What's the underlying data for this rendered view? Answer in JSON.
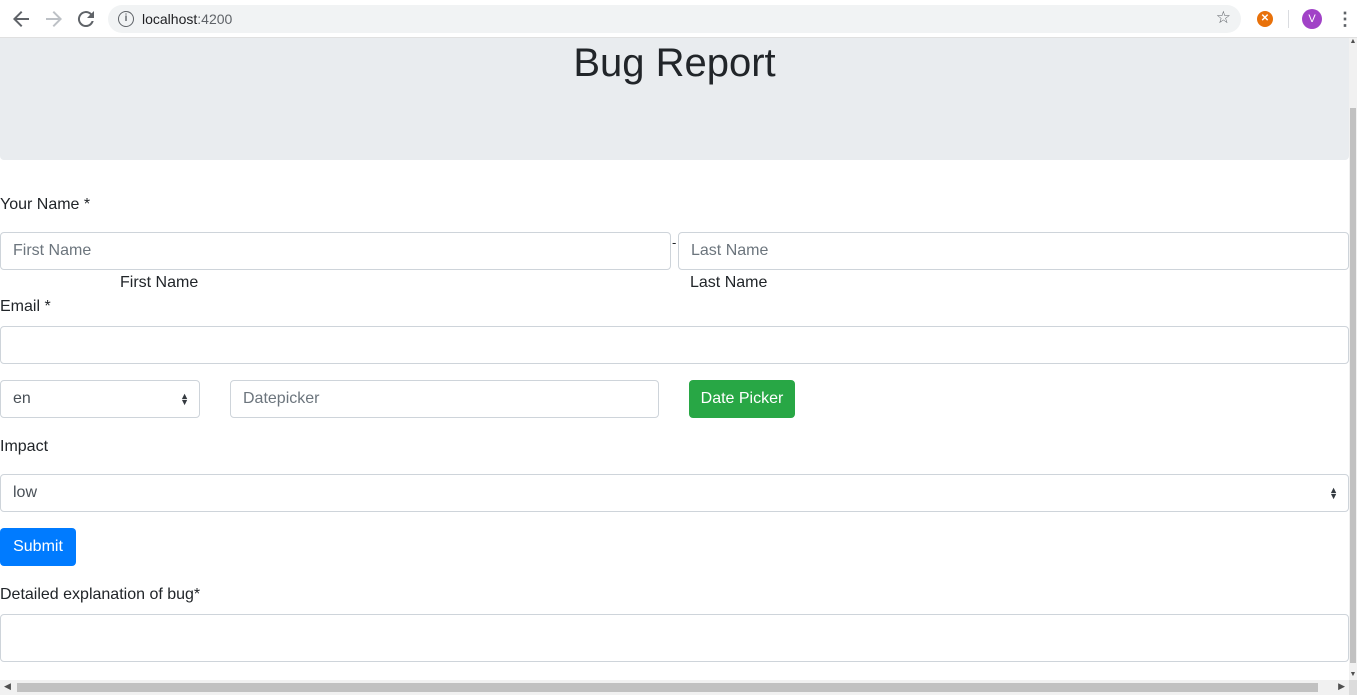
{
  "browser": {
    "url_host": "localhost",
    "url_port": ":4200",
    "avatar_letter": "V"
  },
  "page": {
    "title": "Bug Report",
    "name_label": "Your Name *",
    "first_name_placeholder": "First Name",
    "last_name_placeholder": "Last Name",
    "name_separator": "-",
    "first_name_caption": "First Name",
    "last_name_caption": "Last Name",
    "email_label": "Email *",
    "email_value": "",
    "language_select_value": "en",
    "datepicker_placeholder": "Datepicker",
    "date_picker_button": "Date Picker",
    "impact_label": "Impact",
    "impact_select_value": "low",
    "submit_button": "Submit",
    "explanation_label": "Detailed explanation of bug*",
    "explanation_value": ""
  },
  "colors": {
    "jumbotron_bg": "#e9ecef",
    "success": "#28a745",
    "primary": "#007bff"
  }
}
